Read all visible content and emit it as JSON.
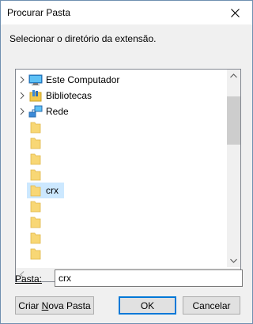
{
  "window": {
    "title": "Procurar Pasta"
  },
  "description": "Selecionar o diretório da extensão.",
  "tree": {
    "items": [
      {
        "label": "Este Computador",
        "icon": "computer-icon",
        "expandable": true
      },
      {
        "label": "Bibliotecas",
        "icon": "libraries-icon",
        "expandable": true
      },
      {
        "label": "Rede",
        "icon": "network-icon",
        "expandable": true
      },
      {
        "label": "",
        "icon": "folder-icon"
      },
      {
        "label": "",
        "icon": "folder-icon"
      },
      {
        "label": "",
        "icon": "folder-icon"
      },
      {
        "label": "",
        "icon": "folder-icon"
      },
      {
        "label": "crx",
        "icon": "folder-icon",
        "selected": true
      },
      {
        "label": "",
        "icon": "folder-icon"
      },
      {
        "label": "",
        "icon": "folder-icon"
      },
      {
        "label": "",
        "icon": "folder-icon"
      }
    ]
  },
  "folder_field": {
    "label": "Pasta:",
    "value": "crx"
  },
  "buttons": {
    "new_folder_pre": "Criar ",
    "new_folder_mnemonic": "N",
    "new_folder_post": "ova Pasta",
    "ok": "OK",
    "cancel": "Cancelar"
  },
  "colors": {
    "selection": "#cce8ff",
    "folder": "#f8d775",
    "accent": "#0078d7"
  }
}
